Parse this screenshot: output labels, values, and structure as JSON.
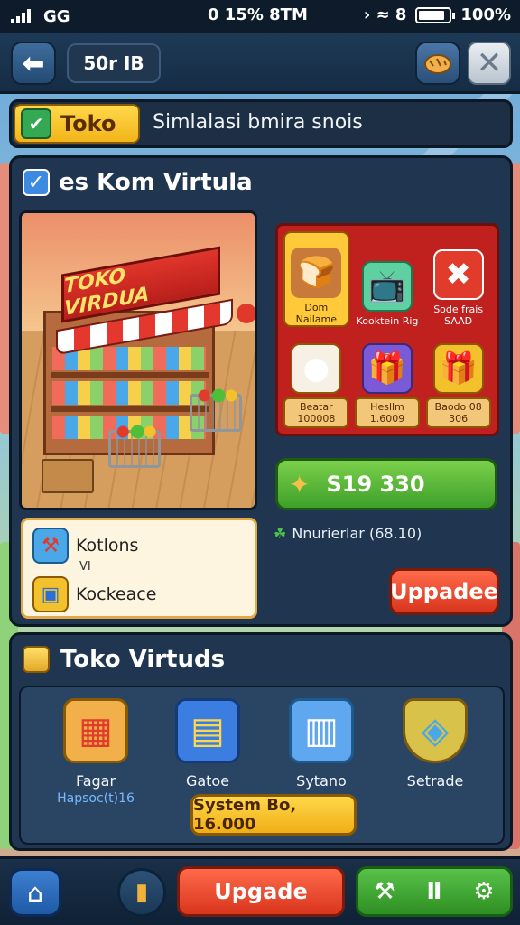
{
  "status_bar": {
    "network": "GG",
    "center": "0 15% 8TM",
    "icons": [
      "signal-icon",
      "wifi-icon",
      "battery-icon"
    ],
    "right_symbols": "› ≈ 8",
    "battery_percent": "100%"
  },
  "top_bar": {
    "level": "50r IB"
  },
  "title_strip": {
    "tag": "Toko",
    "subtitle": "Simlalasi bmira snois"
  },
  "store_panel": {
    "title": "es Kom Virtula",
    "scene_sign": "TOKO VIRDUA",
    "info": {
      "row1_label": "Kotlons",
      "row1_sub": "VI",
      "row2_label": "Kockeace"
    },
    "items": [
      {
        "label": "Dom Nailame",
        "icon": "bread-icon"
      },
      {
        "label": "Kooktein Rig",
        "icon": "tv-icon"
      },
      {
        "label": "Sode frais SAAD",
        "icon": "box-icon"
      },
      {
        "label": "Beatar 100008",
        "icon": "jar-icon"
      },
      {
        "label": "Hesllm 1.6009",
        "icon": "gift-icon"
      },
      {
        "label": "Baodo 08 306",
        "icon": "present-icon"
      }
    ],
    "price": "S19 330",
    "note": "Nnurierlar (68.10)",
    "upgrade_label": "Uppadee"
  },
  "categories_panel": {
    "title": "Toko Virtuds",
    "categories": [
      {
        "name": "Fagar",
        "sub": "Hapsoc(t)16",
        "icon": "crate-icon"
      },
      {
        "name": "Gatoe",
        "sub": "",
        "icon": "cashier-icon"
      },
      {
        "name": "Sytano",
        "sub": "",
        "icon": "fridge-icon"
      },
      {
        "name": "Setrade",
        "sub": "",
        "icon": "shield-icon"
      }
    ],
    "system_button": "System Bo, 16.000"
  },
  "bottom_bar": {
    "upgrade_label": "Upgade"
  },
  "colors": {
    "accent_red": "#d8351d",
    "accent_green": "#3ea02a",
    "accent_gold": "#f0ae17",
    "panel": "#1f3550"
  }
}
